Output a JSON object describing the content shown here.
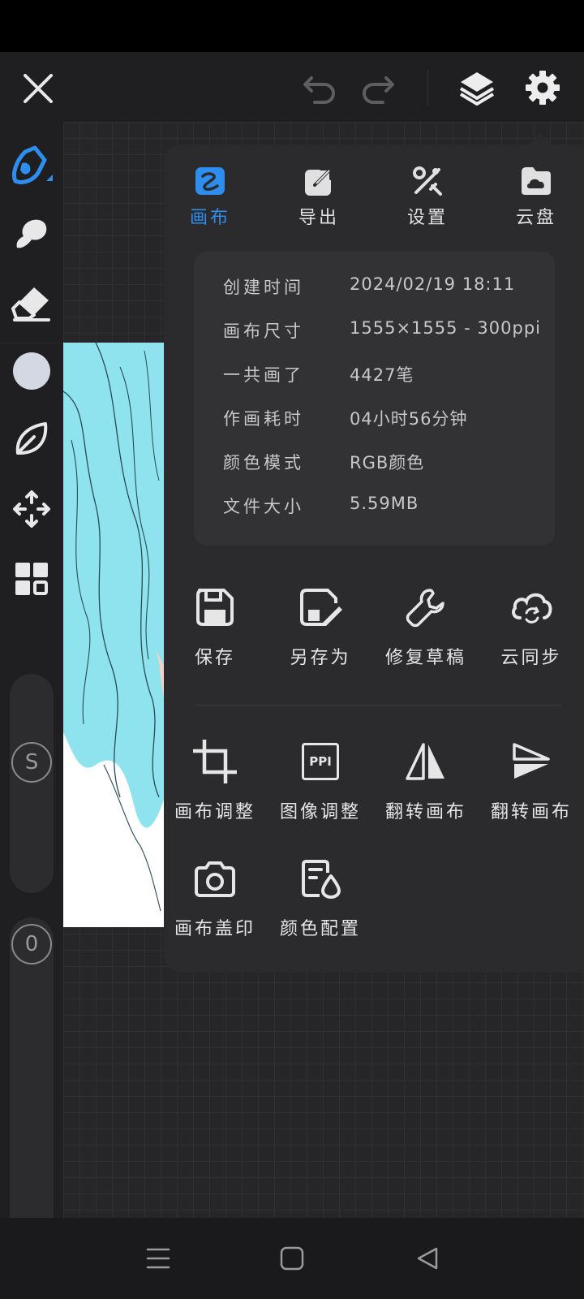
{
  "toolbar": {
    "close_icon": "close-icon",
    "undo_icon": "undo-icon",
    "redo_icon": "redo-icon",
    "layers_icon": "layers-icon",
    "settings_icon": "gear-icon"
  },
  "tools": {
    "brush_size_badge": "S",
    "opacity_badge": "0",
    "color_swatch": "#d4d8e2"
  },
  "panel": {
    "tabs": [
      {
        "label": "画布",
        "icon": "canvas-icon",
        "active": true
      },
      {
        "label": "导出",
        "icon": "export-icon",
        "active": false
      },
      {
        "label": "设置",
        "icon": "tools-icon",
        "active": false
      },
      {
        "label": "云盘",
        "icon": "cloud-drive-icon",
        "active": false
      }
    ],
    "info": [
      {
        "key": "创建时间",
        "value": "2024/02/19 18:11"
      },
      {
        "key": "画布尺寸",
        "value": "1555×1555 - 300ppi"
      },
      {
        "key": "一共画了",
        "value": "4427笔"
      },
      {
        "key": "作画耗时",
        "value": "04小时56分钟"
      },
      {
        "key": "颜色模式",
        "value": "RGB颜色"
      },
      {
        "key": "文件大小",
        "value": "5.59MB"
      }
    ],
    "actions_row1": [
      {
        "label": "保存",
        "icon": "save-icon"
      },
      {
        "label": "另存为",
        "icon": "save-as-icon"
      },
      {
        "label": "修复草稿",
        "icon": "wrench-icon"
      },
      {
        "label": "云同步",
        "icon": "cloud-sync-icon"
      }
    ],
    "actions_row2": [
      {
        "label": "画布调整",
        "icon": "crop-icon"
      },
      {
        "label": "图像调整",
        "icon": "ppi-icon",
        "icon_text": "PPI"
      },
      {
        "label": "翻转画布",
        "icon": "flip-horizontal-icon"
      },
      {
        "label": "翻转画布",
        "icon": "flip-vertical-icon"
      }
    ],
    "actions_row3": [
      {
        "label": "画布盖印",
        "icon": "camera-icon"
      },
      {
        "label": "颜色配置",
        "icon": "color-config-icon"
      }
    ]
  },
  "colors": {
    "accent": "#2d8ef0",
    "hair": "#8fe3ee"
  }
}
